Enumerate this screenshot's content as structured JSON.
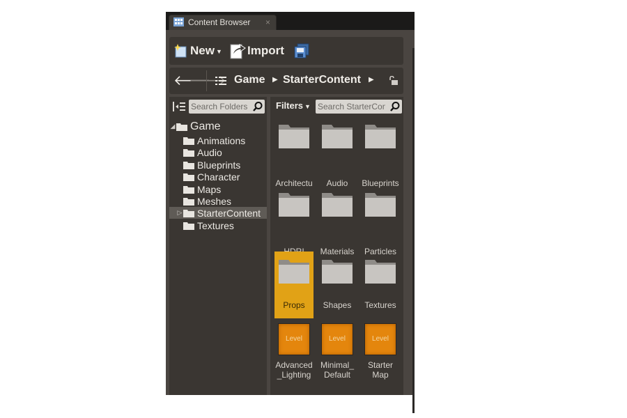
{
  "tab": {
    "title": "Content Browser",
    "close": "×"
  },
  "toolbar": {
    "new_label": "New",
    "import_label": "Import"
  },
  "nav": {
    "back": "🡐",
    "forward": "🡒",
    "crumbs": [
      "Game",
      "StarterContent"
    ]
  },
  "tree": {
    "search_placeholder": "Search Folders",
    "root": "Game",
    "items": [
      "Animations",
      "Audio",
      "Blueprints",
      "Character",
      "Maps",
      "Meshes",
      "StarterContent",
      "Textures"
    ],
    "selected": "StarterContent"
  },
  "grid": {
    "filters_label": "Filters",
    "search_placeholder": "Search StarterCon",
    "folders": [
      "Architectu",
      "Audio",
      "Blueprints",
      "HDRI",
      "Materials",
      "Particles",
      "Props",
      "Shapes",
      "Textures"
    ],
    "selected": "Props",
    "levels": [
      {
        "label": "Advanced\n_Lighting"
      },
      {
        "label": "Minimal_\nDefault"
      },
      {
        "label": "Starter\nMap"
      }
    ],
    "level_badge": "Level"
  },
  "colors": {
    "selection": "#e1a216",
    "level_thumb": "#e4860d",
    "panel": "#3a3632",
    "background": "#4a4541"
  }
}
